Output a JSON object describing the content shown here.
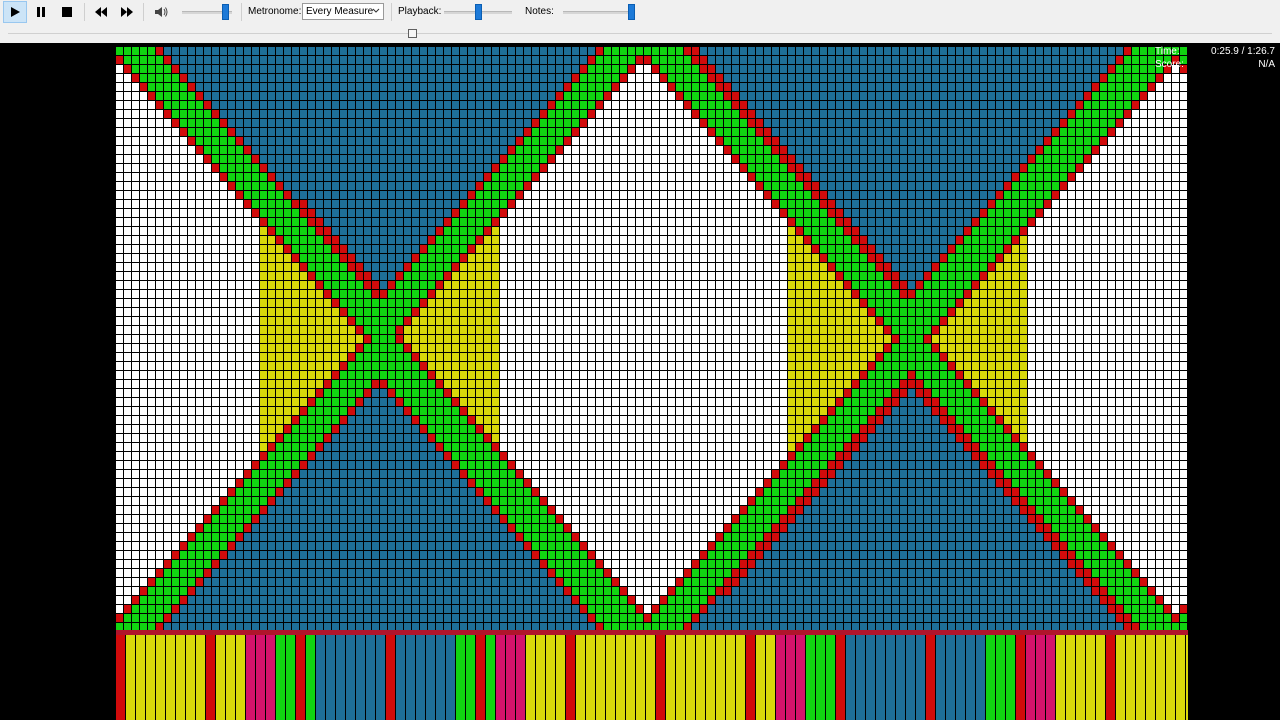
{
  "toolbar": {
    "play_label": "Play",
    "pause_label": "Pause",
    "stop_label": "Stop",
    "rewind_label": "Rewind",
    "forward_label": "Fast Forward",
    "volume_level": 0.85,
    "metronome_label": "Metronome:",
    "metronome_value": "Every Measure",
    "playback_label": "Playback:",
    "playback_level": 0.5,
    "notes_label": "Notes:",
    "notes_level": 1.0
  },
  "seek": {
    "position": 0.32
  },
  "hud": {
    "time_label": "Time:",
    "time_value": "0:25.9 / 1:26.7",
    "score_label": "Score:",
    "score_value": "N/A"
  },
  "colors": {
    "blue": "#1e6f98",
    "green": "#11d411",
    "yellow": "#d8d80a",
    "red": "#d10b0b",
    "magenta": "#d4136b",
    "white": "#ffffff",
    "piano_bar": "#b0142b"
  },
  "icons": {
    "play": "play-icon",
    "pause": "pause-icon",
    "stop": "stop-icon",
    "rewind": "rewind-icon",
    "forward": "fast-forward-icon",
    "volume": "speaker-icon"
  }
}
